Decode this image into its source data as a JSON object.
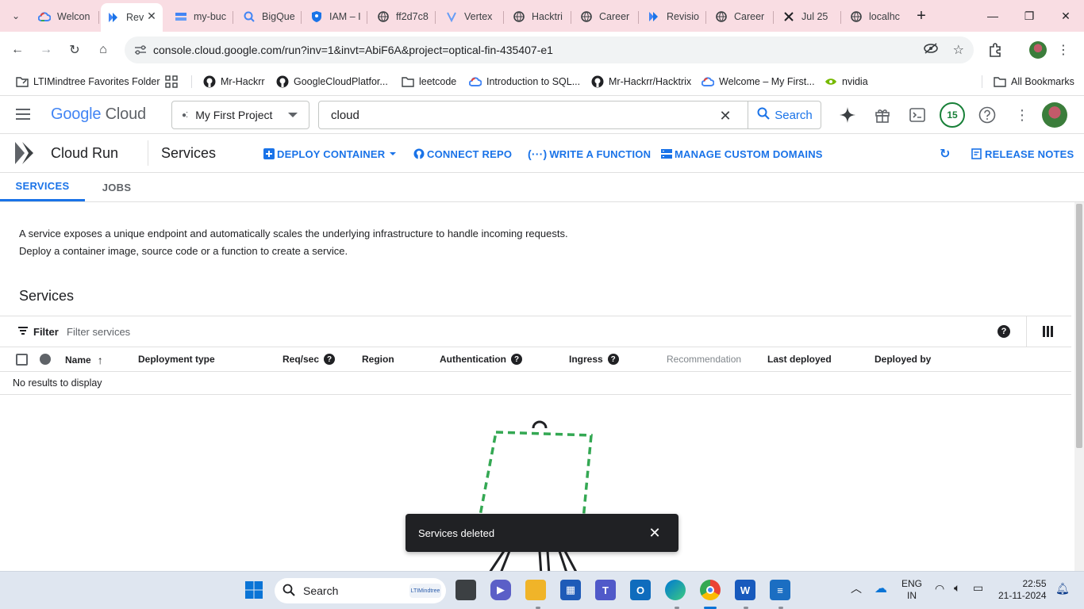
{
  "browser": {
    "tabs": [
      {
        "label": "Welcon",
        "icon": "google-cloud-icon"
      },
      {
        "label": "Rev",
        "icon": "cloud-run-icon",
        "active": true
      },
      {
        "label": "my-buc",
        "icon": "storage-icon"
      },
      {
        "label": "BigQue",
        "icon": "bigquery-icon"
      },
      {
        "label": "IAM – I",
        "icon": "iam-shield-icon"
      },
      {
        "label": "ff2d7c8",
        "icon": "globe-icon"
      },
      {
        "label": "Vertex",
        "icon": "vertex-icon"
      },
      {
        "label": "Hacktri",
        "icon": "globe-icon"
      },
      {
        "label": "Career",
        "icon": "globe-icon"
      },
      {
        "label": "Revisio",
        "icon": "cloud-run-icon"
      },
      {
        "label": "Career",
        "icon": "globe-icon"
      },
      {
        "label": "Jul 25",
        "icon": "x-logo-icon"
      },
      {
        "label": "localhc",
        "icon": "globe-icon"
      }
    ],
    "url": "console.cloud.google.com/run?inv=1&invt=AbiF6A&project=optical-fin-435407-e1",
    "bookmarks": [
      {
        "label": "LTIMindtree Favorites Folder",
        "icon": "folder-icon"
      },
      {
        "label": "",
        "icon": "apps-grid-icon"
      },
      {
        "label": "Mr-Hackrr",
        "icon": "github-icon"
      },
      {
        "label": "GoogleCloudPlatfor...",
        "icon": "github-icon"
      },
      {
        "label": "leetcode",
        "icon": "folder-icon"
      },
      {
        "label": "Introduction to SQL...",
        "icon": "google-cloud-icon"
      },
      {
        "label": "Mr-Hackrr/Hacktrix",
        "icon": "github-icon"
      },
      {
        "label": "Welcome – My First...",
        "icon": "google-cloud-icon"
      },
      {
        "label": "nvidia",
        "icon": "nvidia-icon"
      },
      {
        "label": "All Bookmarks",
        "icon": "folder-icon"
      }
    ]
  },
  "gcp": {
    "logo_google": "Google",
    "logo_cloud": "Cloud",
    "project": "My First Project",
    "search_value": "cloud",
    "search_button": "Search",
    "notifications_count": "15"
  },
  "run": {
    "product": "Cloud Run",
    "page": "Services",
    "actions": {
      "deploy": "DEPLOY CONTAINER",
      "connect": "CONNECT REPO",
      "function": "WRITE A FUNCTION",
      "domains": "MANAGE CUSTOM DOMAINS",
      "release_notes": "RELEASE NOTES"
    },
    "tabs": [
      "SERVICES",
      "JOBS"
    ],
    "desc_line1": "A service exposes a unique endpoint and automatically scales the underlying infrastructure to handle incoming requests.",
    "desc_line2": "Deploy a container image, source code or a function to create a service.",
    "section_title": "Services",
    "filter_label": "Filter",
    "filter_placeholder": "Filter services",
    "columns": {
      "name": "Name",
      "deployment_type": "Deployment type",
      "req_sec": "Req/sec",
      "region": "Region",
      "authentication": "Authentication",
      "ingress": "Ingress",
      "recommendation": "Recommendation",
      "last_deployed": "Last deployed",
      "deployed_by": "Deployed by"
    },
    "empty_text": "No results to display",
    "snackbar_text": "Services deleted"
  },
  "taskbar": {
    "search_placeholder": "Search",
    "search_tag": "LTIMindtree",
    "lang_line1": "ENG",
    "lang_line2": "IN",
    "time": "22:55",
    "date": "21-11-2024"
  }
}
